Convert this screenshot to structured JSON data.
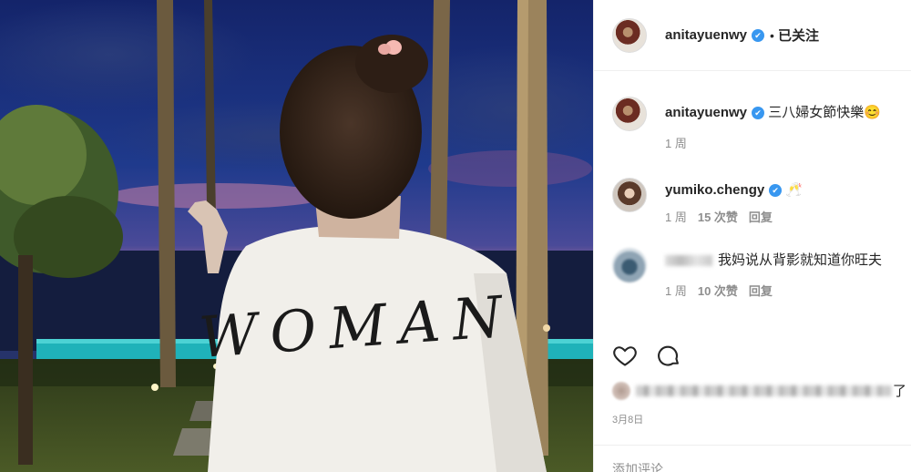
{
  "post": {
    "author": "anitayuenwy",
    "follow_status": "已关注",
    "shirt_text": "WOMAN"
  },
  "comments": [
    {
      "user": "anitayuenwy",
      "text": "三八婦女節快樂😊",
      "time": "1 周",
      "likes": "",
      "reply": ""
    },
    {
      "user": "yumiko.chengy",
      "text": "🥂",
      "time": "1 周",
      "likes": "15 次赞",
      "reply": "回复"
    },
    {
      "user": "",
      "text": "我妈说从背影就知道你旺夫",
      "time": "1 周",
      "likes": "10 次赞",
      "reply": "回复"
    }
  ],
  "actions": {
    "like_icon": "heart-icon",
    "comment_icon": "comment-bubble-icon"
  },
  "likes_tail": "了",
  "date": "3月8日",
  "add_comment_placeholder": "添加评论...",
  "colors": {
    "verified": "#3897f0",
    "meta_gray": "#8e8e8e",
    "text": "#262626"
  }
}
